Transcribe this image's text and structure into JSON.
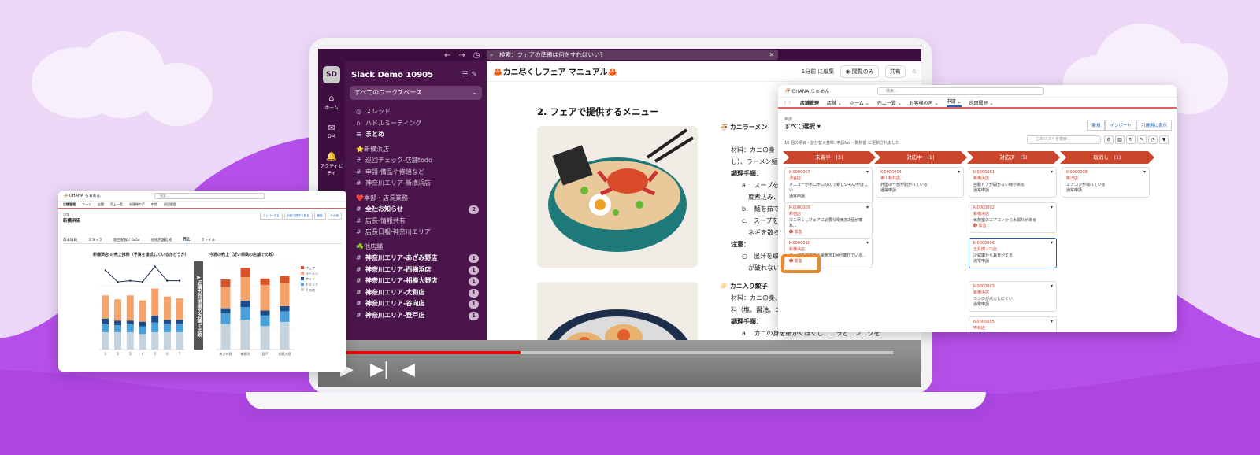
{
  "colors": {
    "slack_aubergine": "#4a154b",
    "slack_rail": "#3f0e40",
    "video_red": "#ee0000",
    "chevron_red": "#c9462d",
    "highlight_orange": "#e98a2e",
    "bg_lavender": "#ecd8f6",
    "wave_purple": "#b44fea"
  },
  "slack": {
    "topbar": {
      "back_icon": "←",
      "forward_icon": "→",
      "history_icon": "clock-icon",
      "search_text": "検索：フェアの準備は何をすればいい？"
    },
    "rail": {
      "workspace_initials": "SD",
      "items": [
        {
          "icon": "home-icon",
          "label": "ホーム"
        },
        {
          "icon": "dm-icon",
          "label": "DM"
        },
        {
          "icon": "bell-icon",
          "label": "アクティビティ",
          "badge": "10"
        }
      ]
    },
    "sidebar": {
      "workspace_name": "Slack Demo 10905",
      "workspace_filter": "すべてのワークスペース",
      "items_top": [
        {
          "icon": "thread-icon",
          "label": "スレッド",
          "bold": false
        },
        {
          "icon": "headphones-icon",
          "label": "ハドルミーティング",
          "bold": false
        },
        {
          "icon": "summary-icon",
          "label": "まとめ",
          "bold": true
        }
      ],
      "sections": [
        {
          "emoji": "⭐",
          "title": "新横浜店",
          "channels": [
            {
              "name": "巡回チェック-店舗todo"
            },
            {
              "name": "申請-備品や修繕など"
            },
            {
              "name": "神奈川エリア-新横浜店"
            }
          ]
        },
        {
          "emoji": "❤️",
          "title": "本部・店長業務",
          "channels": [
            {
              "name": "全社お知らせ",
              "bold": true,
              "badge": "2"
            },
            {
              "name": "店長-情報共有"
            },
            {
              "name": "店長日報-神奈川エリア"
            }
          ]
        },
        {
          "emoji": "☘️",
          "title": "他店舗",
          "channels": [
            {
              "name": "神奈川エリア-あざみ野店",
              "bold": true,
              "badge": "1"
            },
            {
              "name": "神奈川エリア-西横浜店",
              "bold": true,
              "badge": "1"
            },
            {
              "name": "神奈川エリア-相模大野店",
              "bold": true,
              "badge": "1"
            },
            {
              "name": "神奈川エリア-大和店",
              "bold": true,
              "badge": "1"
            },
            {
              "name": "神奈川エリア-谷向店",
              "bold": true,
              "badge": "1"
            },
            {
              "name": "神奈川エリア-登戸店",
              "bold": true,
              "badge": "1"
            }
          ]
        }
      ]
    },
    "canvas": {
      "title": "🦀カニ尽くしフェア マニュアル🦀",
      "edited": "1分前 に編集",
      "view_only": "閲覧のみ",
      "share": "共有",
      "heading": "2. フェアで提供するメニュー",
      "menu1_title": "🍜 カニラーメン",
      "menu1_lines": [
        "材料：カニの身（冷",
        "し）、ラーメン麺",
        "調理手順：",
        "a.　スープをカニ",
        "　度煮込み、味",
        "b.　麺を茹で、湯",
        "c.　スープをかけ",
        "　ネギを散らし",
        "注意：",
        "○　出汁を取った",
        "　が破れないよ"
      ],
      "menu2_title": "🥟 カニ入り餃子",
      "menu2_lines": [
        "材料：カニの身、餃",
        "料（塩、醤油、ゴ",
        "調理手順：",
        "a.　カニの身を細かくほぐし、ニラとニンニクを"
      ]
    }
  },
  "video": {
    "played_percent": 32,
    "buffered_percent": 100,
    "play_icon": "play-icon",
    "next_icon": "skip-next-icon",
    "volume_icon": "volume-icon"
  },
  "kanban": {
    "app_name": "OHANA らぁめん",
    "global_search": "検索...",
    "nav_app": "店舗管理",
    "nav_items": [
      "店舗",
      "ホーム",
      "売上一覧",
      "お客様の声",
      "申請",
      "巡回履歴"
    ],
    "active_nav": "申請",
    "object_label": "申請",
    "list_view": "すべて選択",
    "buttons": [
      "新規",
      "インポート",
      "引継用に表示"
    ],
    "info": "10 個の項目・並び替え基準: 申請No.・数秒前 に更新されました",
    "list_search": "このリストを検索...",
    "stages": [
      {
        "label": "未着手",
        "count": "(3)"
      },
      {
        "label": "対応中",
        "count": "(1)"
      },
      {
        "label": "対応済",
        "count": "(5)"
      },
      {
        "label": "取消し",
        "count": "(1)"
      }
    ],
    "columns": [
      [
        {
          "id": "K-0000007",
          "store": "渋谷店",
          "desc": "メニューがボロボロなので新しいものがほしい",
          "status": "通常申請"
        },
        {
          "id": "K-0000009",
          "store": "新宿店",
          "desc": "カニ尽くしフェアに必要な電気窯1個が壊れ...",
          "status": "緊急",
          "urgent": true
        },
        {
          "id": "K-0000010",
          "store": "新横浜店",
          "desc": "フェアで使用する電気窯1個が壊れている...",
          "status": "緊急",
          "urgent": true
        }
      ],
      [
        {
          "id": "K-0000004",
          "store": "東山新井店",
          "desc": "外壁の一部が剥がれている",
          "status": "通常申請"
        }
      ],
      [
        {
          "id": "K-0000001",
          "store": "新横浜店",
          "desc": "自動ドアが開かない時がある",
          "status": "通常申請"
        },
        {
          "id": "K-0000002",
          "store": "新横浜店",
          "desc": "休憩室のエアコンから水漏れがある",
          "status": "緊急",
          "urgent": true
        },
        {
          "id": "K-0000006",
          "store": "五反田ノロ店",
          "desc": "冷蔵庫から異音がする",
          "status": "通常申請"
        },
        {
          "id": "K-0000003",
          "store": "新横浜店",
          "desc": "コンロが点火しにくい",
          "status": "通常申請"
        },
        {
          "id": "K-0000005",
          "store": "中目店",
          "desc": "テーブルがガタガタする",
          "status": ""
        }
      ],
      [
        {
          "id": "K-0000008",
          "store": "藤沢店",
          "desc": "エアコンが壊れている",
          "status": "通常申請"
        }
      ]
    ],
    "drag_plus": "+"
  },
  "report": {
    "app_name": "OHANA らぁめん",
    "search": "検索...",
    "nav_app": "店舗管理",
    "nav_items": [
      "ホーム",
      "店舗",
      "売上一覧",
      "お客様の声",
      "申請",
      "巡回履歴"
    ],
    "record_type": "店舗",
    "record_name": "新横浜店",
    "tabs": [
      "基本情報",
      "スタッフ",
      "巡回記録 / ToDo",
      "地域店舗比較",
      "売上",
      "ファイル"
    ],
    "chart1_title": "新横浜店 の売上推移（予算を達成しているかどうか）",
    "chart2_title": "今週の売上（近い規模の店舗で比較）",
    "side_button": "▶近隣の同規模の店舗で比較",
    "header_buttons": [
      "フォローする",
      "分析で傾向を見る",
      "編集",
      "その他"
    ]
  },
  "chart_data": [
    {
      "type": "bar",
      "stacked": true,
      "title": "新横浜店 の売上推移（予算を達成しているかどうか）",
      "categories": [
        "1",
        "2",
        "3",
        "4",
        "5",
        "6",
        "7"
      ],
      "series": [
        {
          "name": "その他",
          "color": "#c5d3df",
          "values": [
            45,
            45,
            45,
            40,
            45,
            45,
            45
          ]
        },
        {
          "name": "ドリンク",
          "color": "#4aa0d8",
          "values": [
            20,
            18,
            20,
            20,
            25,
            20,
            20
          ]
        },
        {
          "name": "サイド",
          "color": "#1c4f8a",
          "values": [
            15,
            12,
            10,
            12,
            18,
            12,
            12
          ]
        },
        {
          "name": "ラーメン",
          "color": "#f5a36b",
          "values": [
            60,
            55,
            65,
            55,
            70,
            60,
            55
          ]
        }
      ],
      "line": {
        "name": "予算",
        "values": [
          205,
          175,
          178,
          175,
          215,
          178,
          178
        ]
      },
      "ylim": [
        0,
        220
      ]
    },
    {
      "type": "bar",
      "stacked": true,
      "title": "今週の売上（近い規模の店舗で比較）",
      "categories": [
        "あざみ野",
        "新横浜",
        "登戸",
        "相模大野"
      ],
      "series": [
        {
          "name": "その他",
          "color": "#c5d3df",
          "values": [
            60,
            70,
            55,
            65
          ]
        },
        {
          "name": "ドリンク",
          "color": "#4aa0d8",
          "values": [
            25,
            30,
            25,
            25
          ]
        },
        {
          "name": "サイド",
          "color": "#1c4f8a",
          "values": [
            12,
            15,
            12,
            12
          ]
        },
        {
          "name": "ラーメン",
          "color": "#f5a36b",
          "values": [
            50,
            55,
            60,
            55
          ]
        },
        {
          "name": "フェア",
          "color": "#d9542b",
          "values": [
            18,
            22,
            15,
            16
          ]
        }
      ],
      "ylim": [
        0,
        200
      ]
    }
  ]
}
